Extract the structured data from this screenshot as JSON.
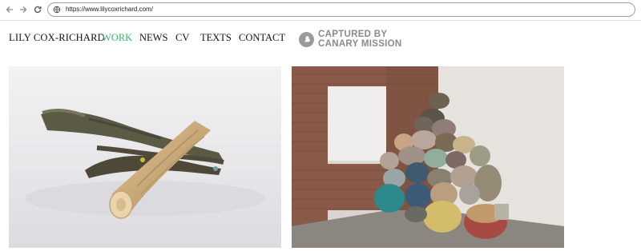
{
  "browser": {
    "url": "https://www.lilycoxrichard.com/"
  },
  "site": {
    "brand": "LILY COX-RICHARD",
    "menu": [
      {
        "label": "WORK",
        "active": true
      },
      {
        "label": "NEWS",
        "active": false
      },
      {
        "label": "CV",
        "active": false
      },
      {
        "label": "TEXTS",
        "active": false
      },
      {
        "label": "CONTACT",
        "active": false
      }
    ],
    "accent_color": "#3cb371"
  },
  "overlay": {
    "line1": "CAPTURED BY",
    "line2": "CANARY MISSION",
    "icon": "canary-bird-icon"
  },
  "icons": {
    "back": "arrow-left-icon",
    "forward": "arrow-right-icon",
    "reload": "reload-icon",
    "site_info": "site-info-icon"
  }
}
